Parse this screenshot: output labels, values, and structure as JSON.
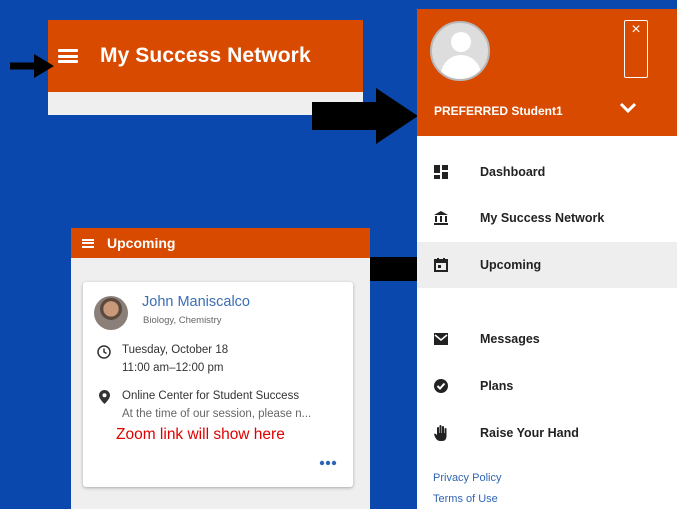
{
  "header": {
    "title": "My Success Network"
  },
  "drawer": {
    "user_name": "PREFERRED Student1",
    "close_label": "×",
    "items": [
      {
        "label": "Dashboard",
        "icon": "dashboard-icon"
      },
      {
        "label": "My Success Network",
        "icon": "bank-icon"
      },
      {
        "label": "Upcoming",
        "icon": "calendar-icon",
        "active": true
      },
      {
        "label": "Messages",
        "icon": "envelope-icon"
      },
      {
        "label": "Plans",
        "icon": "check-circle-icon"
      },
      {
        "label": "Raise Your Hand",
        "icon": "hand-icon"
      }
    ],
    "footer_links": [
      "Privacy Policy",
      "Terms of Use"
    ]
  },
  "upcoming": {
    "title": "Upcoming",
    "card": {
      "name": "John Maniscalco",
      "subjects": "Biology, Chemistry",
      "date": "Tuesday, October 18",
      "time": "11:00 am–12:00 pm",
      "location": "Online Center for Student Success",
      "note": "At the time of our session, please n...",
      "zoom_note": "Zoom link will show here"
    }
  },
  "colors": {
    "background": "#0b48ad",
    "brand_orange": "#d84a00",
    "link_blue": "#2f66b3",
    "annotation_red": "#e00000"
  }
}
